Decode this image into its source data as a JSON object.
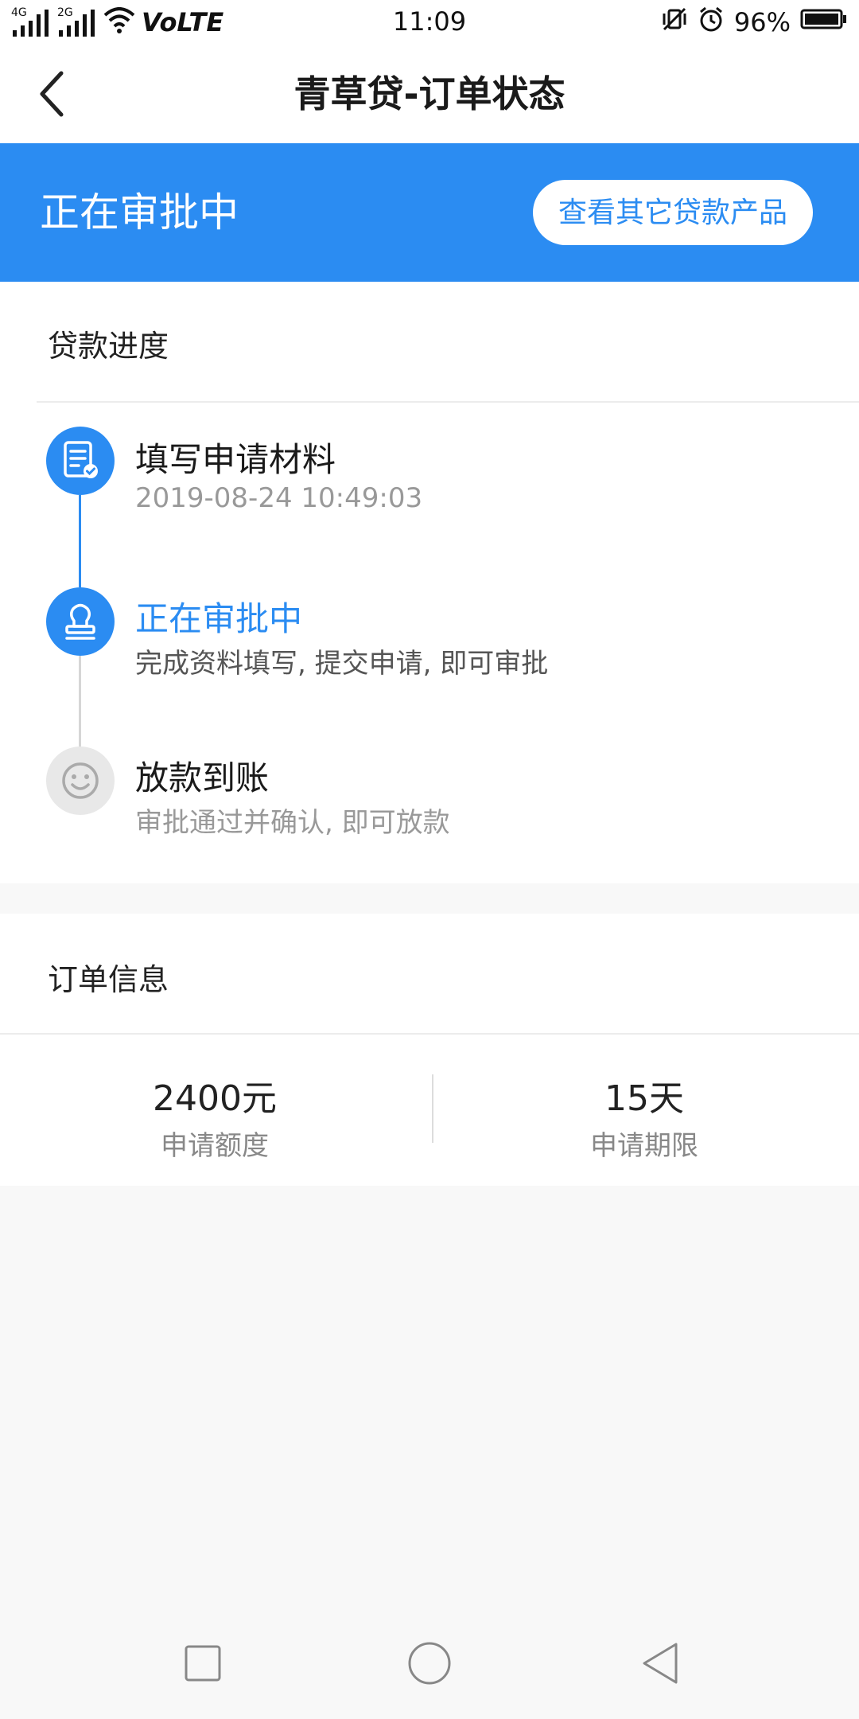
{
  "status_bar": {
    "network_4g": "4G",
    "network_2g": "2G",
    "volte": "VoLTE",
    "time": "11:09",
    "battery": "96%"
  },
  "header": {
    "title": "青草贷-订单状态",
    "back_icon": "chevron-left-icon"
  },
  "banner": {
    "status": "正在审批中",
    "button_label": "查看其它贷款产品",
    "color": "#2b8cf2"
  },
  "progress": {
    "section_title": "贷款进度",
    "steps": [
      {
        "title": "填写申请材料",
        "desc": "2019-08-24 10:49:03",
        "icon": "document-check-icon",
        "state": "done"
      },
      {
        "title": "正在审批中",
        "desc": "完成资料填写, 提交申请, 即可审批",
        "icon": "stamp-icon",
        "state": "current"
      },
      {
        "title": "放款到账",
        "desc": "审批通过并确认, 即可放款",
        "icon": "smiley-icon",
        "state": "pending"
      }
    ]
  },
  "order": {
    "section_title": "订单信息",
    "amount_value": "2400元",
    "amount_label": "申请额度",
    "term_value": "15天",
    "term_label": "申请期限"
  }
}
